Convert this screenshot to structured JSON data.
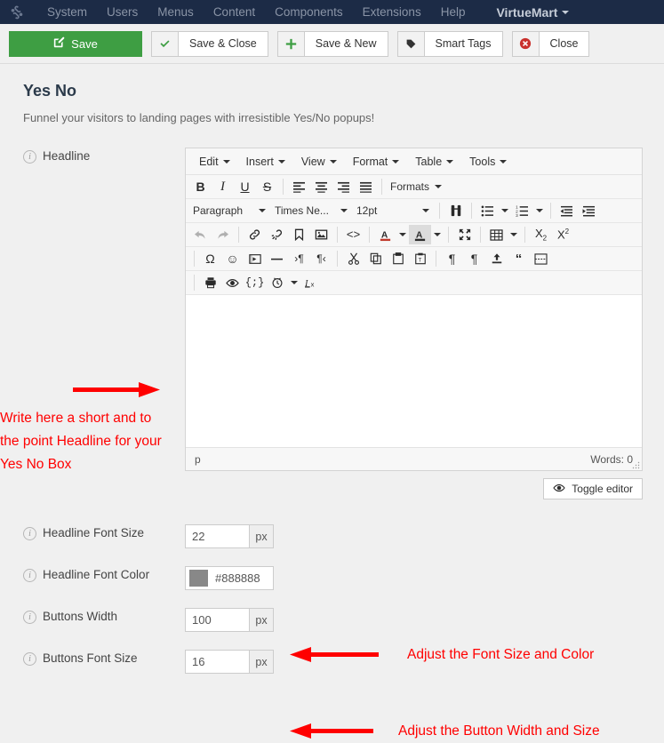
{
  "topbar": {
    "logo_name": "joomla-logo",
    "items": [
      {
        "label": "System"
      },
      {
        "label": "Users"
      },
      {
        "label": "Menus"
      },
      {
        "label": "Content"
      },
      {
        "label": "Components"
      },
      {
        "label": "Extensions"
      },
      {
        "label": "Help"
      }
    ],
    "brand": "VirtueMart"
  },
  "toolbar": {
    "save": "Save",
    "save_close": "Save & Close",
    "save_new": "Save & New",
    "smart_tags": "Smart Tags",
    "close": "Close"
  },
  "page": {
    "title": "Yes No",
    "subtitle": "Funnel your visitors to landing pages with irresistible Yes/No popups!"
  },
  "editor": {
    "label": "Headline",
    "menu": [
      "Edit",
      "Insert",
      "View",
      "Format",
      "Table",
      "Tools"
    ],
    "formats_label": "Formats",
    "block_format": "Paragraph",
    "font_family": "Times Ne...",
    "font_size": "12pt",
    "status_path": "p",
    "word_count": "Words: 0",
    "toggle_editor": "Toggle editor"
  },
  "fields": [
    {
      "label": "Headline Font Size",
      "value": "22",
      "unit": "px",
      "type": "number"
    },
    {
      "label": "Headline Font Color",
      "value": "#888888",
      "swatch": "#888888",
      "type": "color"
    },
    {
      "label": "Buttons Width",
      "value": "100",
      "unit": "px",
      "type": "number"
    },
    {
      "label": "Buttons Font Size",
      "value": "16",
      "unit": "px",
      "type": "number"
    }
  ],
  "annotations": {
    "headline": "Write here a short and to the point Headline for your Yes No Box",
    "font": "Adjust the Font Size and Color",
    "buttons": "Adjust the Button Width and Size",
    "color": "#ff0000"
  }
}
